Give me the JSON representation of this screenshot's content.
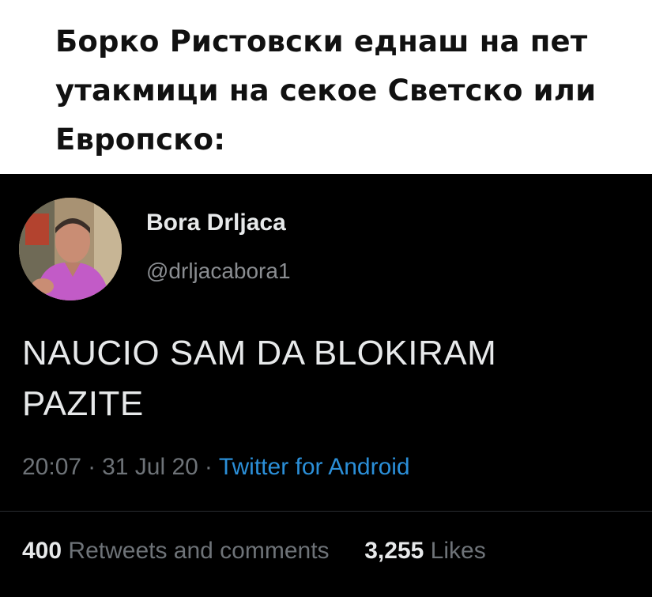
{
  "caption": {
    "line1": "Борко Ристовски еднаш на пет",
    "line2": "утакмици на секое Светско или",
    "line3": "Европско:"
  },
  "tweet": {
    "display_name": "Bora Drljaca",
    "handle": "@drljacabora1",
    "text_line1": "NAUCIO SAM DA BLOKIRAM",
    "text_line2": "PAZITE",
    "time": "20:07",
    "date": "31 Jul 20",
    "separator": "·",
    "source": "Twitter for Android",
    "retweets_count": "400",
    "retweets_label": "Retweets and comments",
    "likes_count": "3,255",
    "likes_label": "Likes"
  },
  "colors": {
    "tweet_background": "#000000",
    "source_link": "#2b8fd8",
    "secondary_text": "#6e7378"
  }
}
